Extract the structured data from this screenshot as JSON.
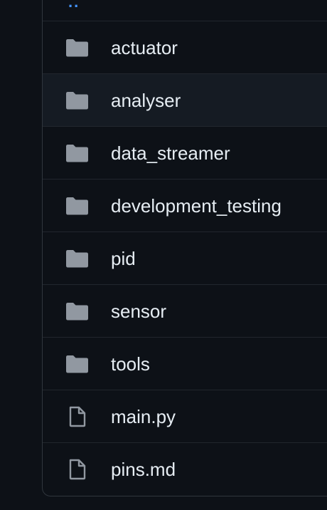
{
  "file_list": {
    "parent_link_label": "..",
    "items": [
      {
        "name": "actuator",
        "type": "folder",
        "icon": "folder-icon"
      },
      {
        "name": "analyser",
        "type": "folder",
        "icon": "folder-icon"
      },
      {
        "name": "data_streamer",
        "type": "folder",
        "icon": "folder-icon"
      },
      {
        "name": "development_testing",
        "type": "folder",
        "icon": "folder-icon"
      },
      {
        "name": "pid",
        "type": "folder",
        "icon": "folder-icon"
      },
      {
        "name": "sensor",
        "type": "folder",
        "icon": "folder-icon"
      },
      {
        "name": "tools",
        "type": "folder",
        "icon": "folder-icon"
      },
      {
        "name": "main.py",
        "type": "file",
        "icon": "file-icon"
      },
      {
        "name": "pins.md",
        "type": "file",
        "icon": "file-icon"
      }
    ]
  },
  "colors": {
    "background": "#0d1117",
    "text": "#e6edf3",
    "icon": "#9198a1",
    "link": "#4493f8",
    "border": "#30363d",
    "hover_row": "#151b23"
  }
}
